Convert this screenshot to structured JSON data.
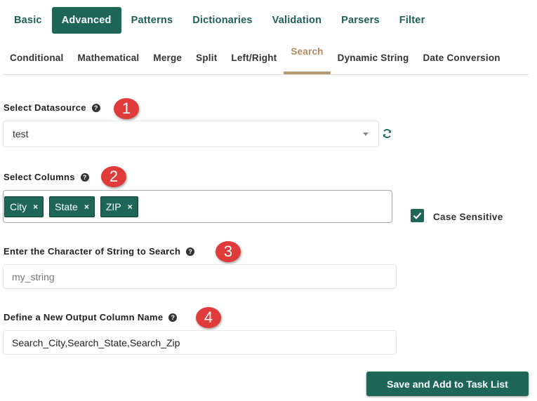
{
  "tabs_primary": [
    {
      "label": "Basic"
    },
    {
      "label": "Advanced",
      "active": true
    },
    {
      "label": "Patterns"
    },
    {
      "label": "Dictionaries"
    },
    {
      "label": "Validation"
    },
    {
      "label": "Parsers"
    },
    {
      "label": "Filter"
    }
  ],
  "tabs_secondary": [
    {
      "label": "Conditional"
    },
    {
      "label": "Mathematical"
    },
    {
      "label": "Merge"
    },
    {
      "label": "Split"
    },
    {
      "label": "Left/Right"
    },
    {
      "label": "Search",
      "active": true
    },
    {
      "label": "Dynamic String"
    },
    {
      "label": "Date Conversion"
    }
  ],
  "datasource": {
    "label": "Select Datasource",
    "value": "test",
    "marker": "1"
  },
  "columns": {
    "label": "Select Columns",
    "marker": "2",
    "chips": [
      {
        "label": "City",
        "remove": "×"
      },
      {
        "label": "State",
        "remove": "×"
      },
      {
        "label": "ZIP",
        "remove": "×"
      }
    ]
  },
  "case_sensitive": {
    "label": "Case Sensitive",
    "checked": true
  },
  "search_string": {
    "label": "Enter the Character of String to Search",
    "marker": "3",
    "placeholder": "my_string"
  },
  "output_column": {
    "label": "Define a New Output Column Name",
    "marker": "4",
    "value": "Search_City,Search_State,Search_Zip"
  },
  "save_button": {
    "label": "Save and Add to Task List"
  },
  "help_glyph": "?",
  "colors": {
    "primary": "#1e6758",
    "active_tab_text": "#b08a5e",
    "marker": "#e03b3b"
  }
}
